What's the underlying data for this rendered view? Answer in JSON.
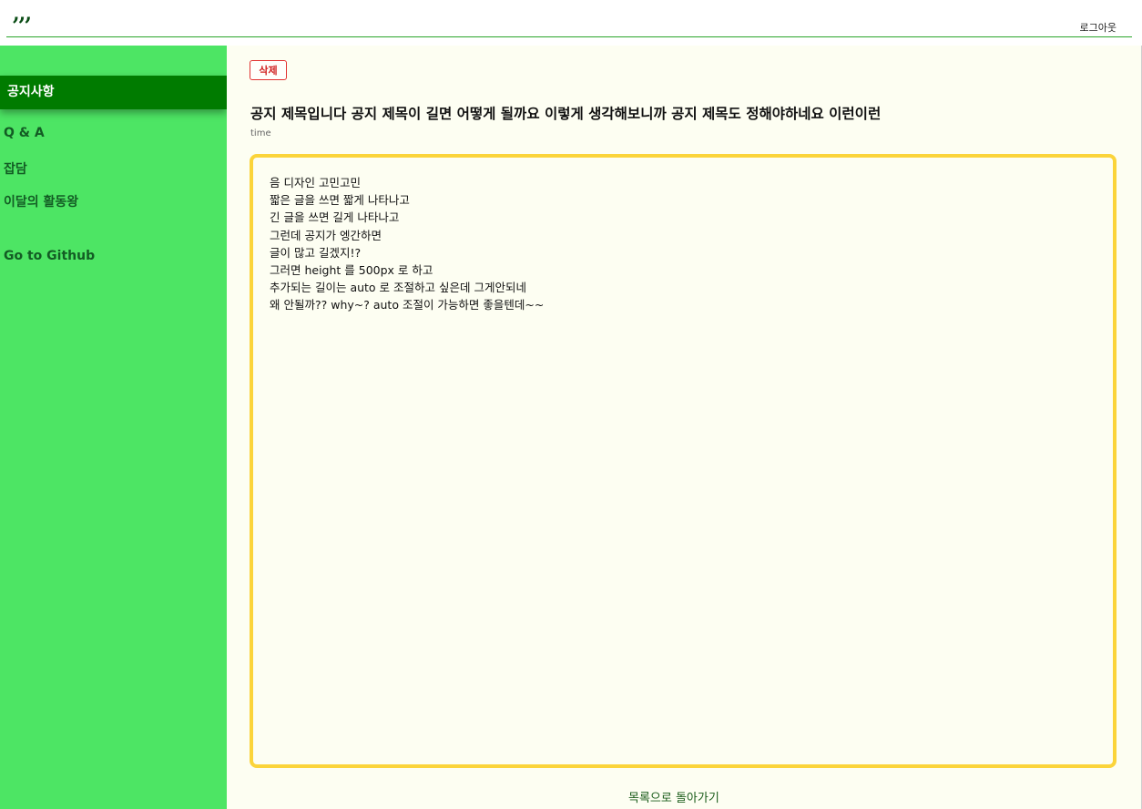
{
  "header": {
    "logo": ",,,",
    "logout_label": "로그아웃"
  },
  "sidebar": {
    "items": [
      {
        "label": "공지사항",
        "active": true
      },
      {
        "label": "Q & A"
      },
      {
        "label": "잡담"
      },
      {
        "label": "이달의 활동왕"
      },
      {
        "label": "Go to Github"
      }
    ]
  },
  "post": {
    "delete_label": "삭제",
    "title": "공지 제목입니다 공지 제목이 길면 어떻게 될까요 이렇게 생각해보니까 공지 제목도 정해야하네요 이런이런",
    "time": "time",
    "content_lines": [
      "음 디자인 고민고민",
      "짧은 글을 쓰면 짧게 나타나고",
      "긴 글을 쓰면 길게 나타나고",
      "그런데 공지가 엥간하면",
      "글이 많고 길겠지!?",
      "그러면 height 를 500px 로 하고",
      "추가되는 길이는 auto 로 조절하고 싶은데 그게안되네",
      "왜 안될까?? why~? auto 조절이 가능하면 좋을텐데~~"
    ],
    "back_label": "목록으로 돌아가기"
  },
  "colors": {
    "sidebar_bg": "#4de564",
    "active_item_bg": "#007b00",
    "content_border": "#fbd43a",
    "delete_border": "#e23131",
    "page_bg": "#fdfef2"
  }
}
